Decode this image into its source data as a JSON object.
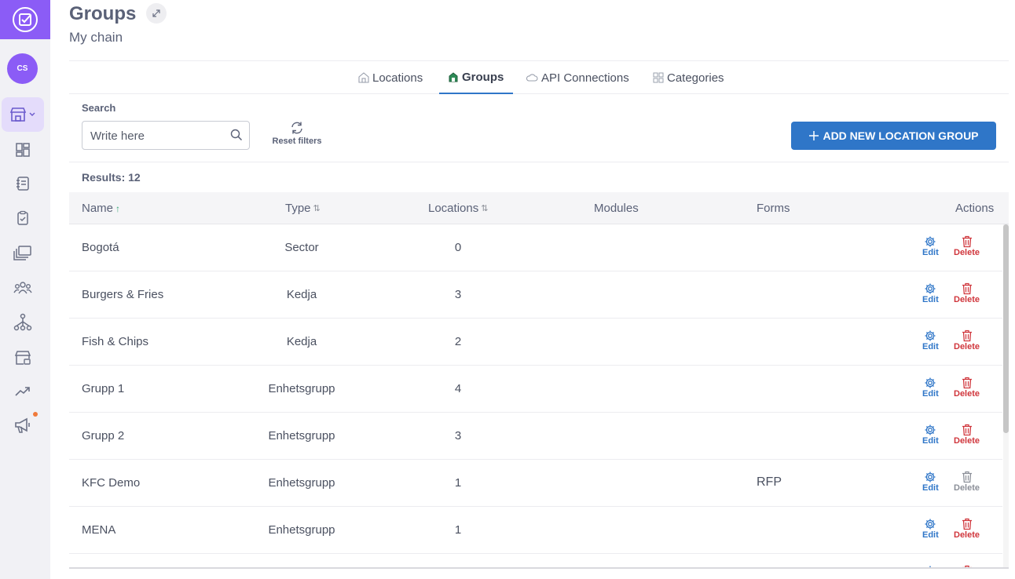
{
  "app": {
    "avatar_initials": "CS",
    "accent": "#8b5cf6",
    "nav_icons": [
      "store-icon",
      "dashboard-icon",
      "notebook-icon",
      "clipboard-check-icon",
      "layers-icon",
      "users-icon",
      "hierarchy-icon",
      "store-settings-icon",
      "trend-up-icon",
      "megaphone-icon"
    ]
  },
  "header": {
    "title": "Groups",
    "subtitle": "My chain"
  },
  "tabs": [
    {
      "label": "Locations",
      "icon": "home-icon"
    },
    {
      "label": "Groups",
      "icon": "building-icon",
      "active": true
    },
    {
      "label": "API Connections",
      "icon": "cloud-icon"
    },
    {
      "label": "Categories",
      "icon": "grid-icon"
    }
  ],
  "toolbar": {
    "search_label": "Search",
    "search_placeholder": "Write here",
    "reset_label": "Reset filters",
    "add_label": "ADD NEW LOCATION GROUP",
    "add_color": "#2f76c8"
  },
  "results_text": "Results: 12",
  "table": {
    "columns": [
      "Name",
      "Type",
      "Locations",
      "Modules",
      "Forms",
      "Actions"
    ],
    "edit_label": "Edit",
    "delete_label": "Delete",
    "rows": [
      {
        "name": "Bogotá",
        "type": "Sector",
        "locations": "0",
        "modules": "",
        "forms": "",
        "delete_enabled": true
      },
      {
        "name": "Burgers & Fries",
        "type": "Kedja",
        "locations": "3",
        "modules": "",
        "forms": "",
        "delete_enabled": true
      },
      {
        "name": "Fish & Chips",
        "type": "Kedja",
        "locations": "2",
        "modules": "",
        "forms": "",
        "delete_enabled": true
      },
      {
        "name": "Grupp 1",
        "type": "Enhetsgrupp",
        "locations": "4",
        "modules": "",
        "forms": "",
        "delete_enabled": true
      },
      {
        "name": "Grupp 2",
        "type": "Enhetsgrupp",
        "locations": "3",
        "modules": "",
        "forms": "",
        "delete_enabled": true
      },
      {
        "name": "KFC Demo",
        "type": "Enhetsgrupp",
        "locations": "1",
        "modules": "",
        "forms": "RFP",
        "delete_enabled": false
      },
      {
        "name": "MENA",
        "type": "Enhetsgrupp",
        "locations": "1",
        "modules": "",
        "forms": "",
        "delete_enabled": true
      },
      {
        "name": "",
        "type": "",
        "locations": "",
        "modules": "",
        "forms": "",
        "delete_enabled": true
      }
    ]
  }
}
